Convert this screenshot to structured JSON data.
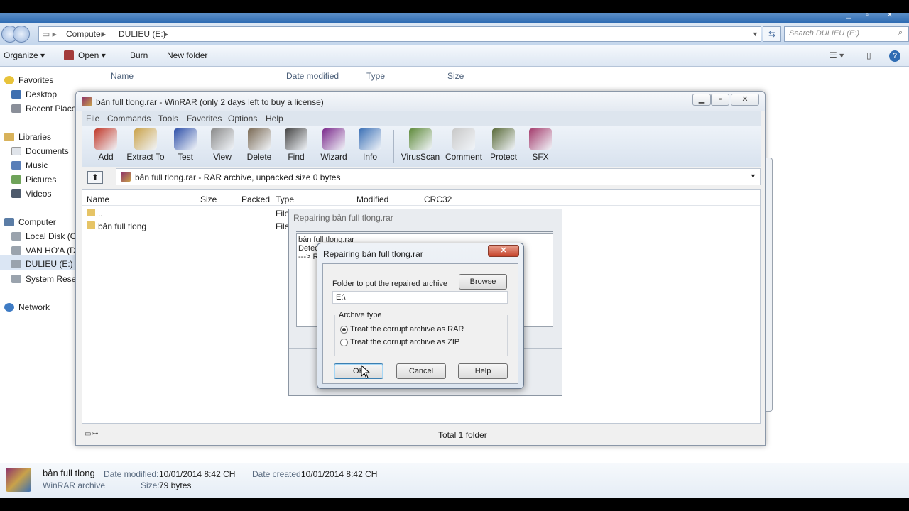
{
  "explorer": {
    "breadcrumb": [
      "Computer",
      "DULIEU (E:)"
    ],
    "search_placeholder": "Search DULIEU (E:)",
    "toolbar": {
      "organize": "Organize",
      "open": "Open",
      "burn": "Burn",
      "new_folder": "New folder"
    },
    "nav": {
      "favorites": "Favorites",
      "desktop": "Desktop",
      "recent_places": "Recent Places",
      "libraries": "Libraries",
      "documents": "Documents",
      "music": "Music",
      "pictures": "Pictures",
      "videos": "Videos",
      "computer": "Computer",
      "local_disk": "Local Disk (C:)",
      "van_hoa": "VAN HO'A (D:",
      "dulieu": "DULIEU (E:)",
      "system_reserved": "System Reserv",
      "network": "Network"
    },
    "columns": {
      "name": "Name",
      "date_modified": "Date modified",
      "type": "Type",
      "size": "Size"
    },
    "details": {
      "file_name": "bản full tlong",
      "file_type": "WinRAR archive",
      "date_modified_label": "Date modified:",
      "date_modified": "10/01/2014 8:42 CH",
      "date_created_label": "Date created:",
      "date_created": "10/01/2014 8:42 CH",
      "size_label": "Size:",
      "size": "79 bytes"
    }
  },
  "winrar": {
    "title": "bản full tlong.rar - WinRAR (only 2 days left to buy a license)",
    "menu": [
      "File",
      "Commands",
      "Tools",
      "Favorites",
      "Options",
      "Help"
    ],
    "tools": [
      {
        "label": "Add",
        "color": "#c0392b"
      },
      {
        "label": "Extract To",
        "color": "#c9a24a"
      },
      {
        "label": "Test",
        "color": "#2e4fa8"
      },
      {
        "label": "View",
        "color": "#8a8a8a"
      },
      {
        "label": "Delete",
        "color": "#7a6a55"
      },
      {
        "label": "Find",
        "color": "#444444"
      },
      {
        "label": "Wizard",
        "color": "#7b2a8c"
      },
      {
        "label": "Info",
        "color": "#3a6fb5"
      },
      {
        "label": "VirusScan",
        "color": "#5e8a3a"
      },
      {
        "label": "Comment",
        "color": "#c8c8c8"
      },
      {
        "label": "Protect",
        "color": "#5a6b3a"
      },
      {
        "label": "SFX",
        "color": "#a33b6c"
      }
    ],
    "path": "bản full tlong.rar - RAR archive, unpacked size 0 bytes",
    "columns": {
      "name": "Name",
      "size": "Size",
      "packed": "Packed",
      "type": "Type",
      "modified": "Modified",
      "crc": "CRC32"
    },
    "rows": [
      {
        "name": "..",
        "type": "File"
      },
      {
        "name": "bản full tlong",
        "type": "File"
      }
    ],
    "status": "Total 1 folder"
  },
  "repair_back": {
    "title": "Repairing bản full tlong.rar",
    "log": [
      "bản full tlong.rar",
      "Detec",
      "---> R"
    ]
  },
  "repair_dialog": {
    "title": "Repairing bản full tlong.rar",
    "folder_label": "Folder to put the repaired archive",
    "browse": "Browse",
    "folder_value": "E:\\",
    "archive_type_label": "Archive type",
    "opt_rar": "Treat the corrupt archive as RAR",
    "opt_zip": "Treat the corrupt archive as ZIP",
    "ok": "OK",
    "cancel": "Cancel",
    "help": "Help"
  }
}
